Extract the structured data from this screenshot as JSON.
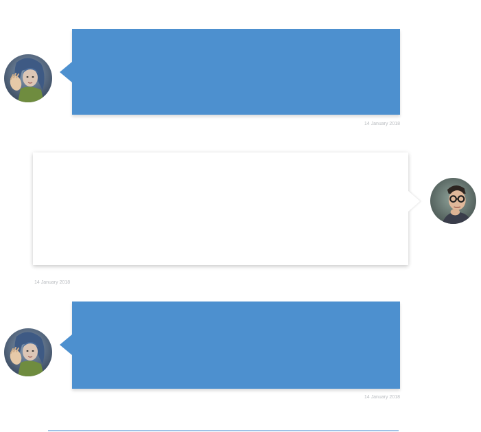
{
  "conversation": {
    "messages": [
      {
        "sender": "woman-avatar",
        "side": "left",
        "style": "blue",
        "timestamp": "14 January 2018",
        "text": ""
      },
      {
        "sender": "man-avatar",
        "side": "right",
        "style": "white",
        "timestamp": "14 January 2018",
        "text": ""
      },
      {
        "sender": "woman-avatar",
        "side": "left",
        "style": "blue",
        "timestamp": "14 January 2018",
        "text": ""
      }
    ]
  },
  "colors": {
    "incoming_bubble": "#4d90cf",
    "outgoing_bubble": "#ffffff",
    "timestamp_text": "#b9bcc0",
    "next_bubble_edge": "#9ec2e6"
  },
  "icons": {
    "woman_avatar": "woman-avatar-photo",
    "man_avatar": "man-avatar-photo"
  }
}
